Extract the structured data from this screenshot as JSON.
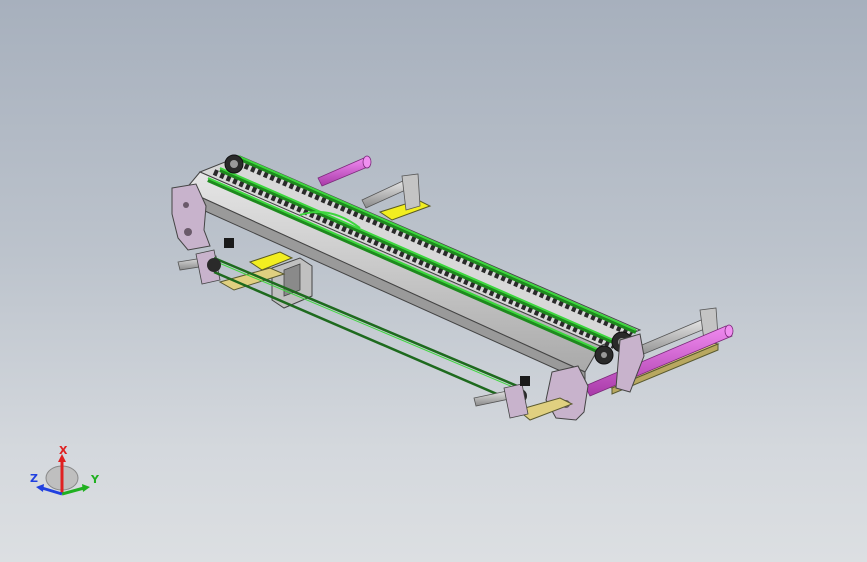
{
  "viewport": {
    "background_top": "#a7b0bd",
    "background_bottom": "#dcdfe2"
  },
  "model": {
    "description_icon": "conveyor-assembly-model",
    "colors": {
      "frame": "#c9c9c9",
      "frame_dark": "#8f8f8f",
      "belt": "#3ed63e",
      "belt_dark": "#1e8a1e",
      "chain": "#2a2a2a",
      "bracket": "#c8b3cc",
      "shaft_magenta": "#d45ad4",
      "base_plate": "#e0d080",
      "yellow_block": "#f2ee20",
      "shaft_grey": "#b0b0b0"
    }
  },
  "triad": {
    "x_label": "X",
    "y_label": "Y",
    "z_label": "Z",
    "x_color": "#e02020",
    "y_color": "#20b020",
    "z_color": "#2040e0"
  }
}
